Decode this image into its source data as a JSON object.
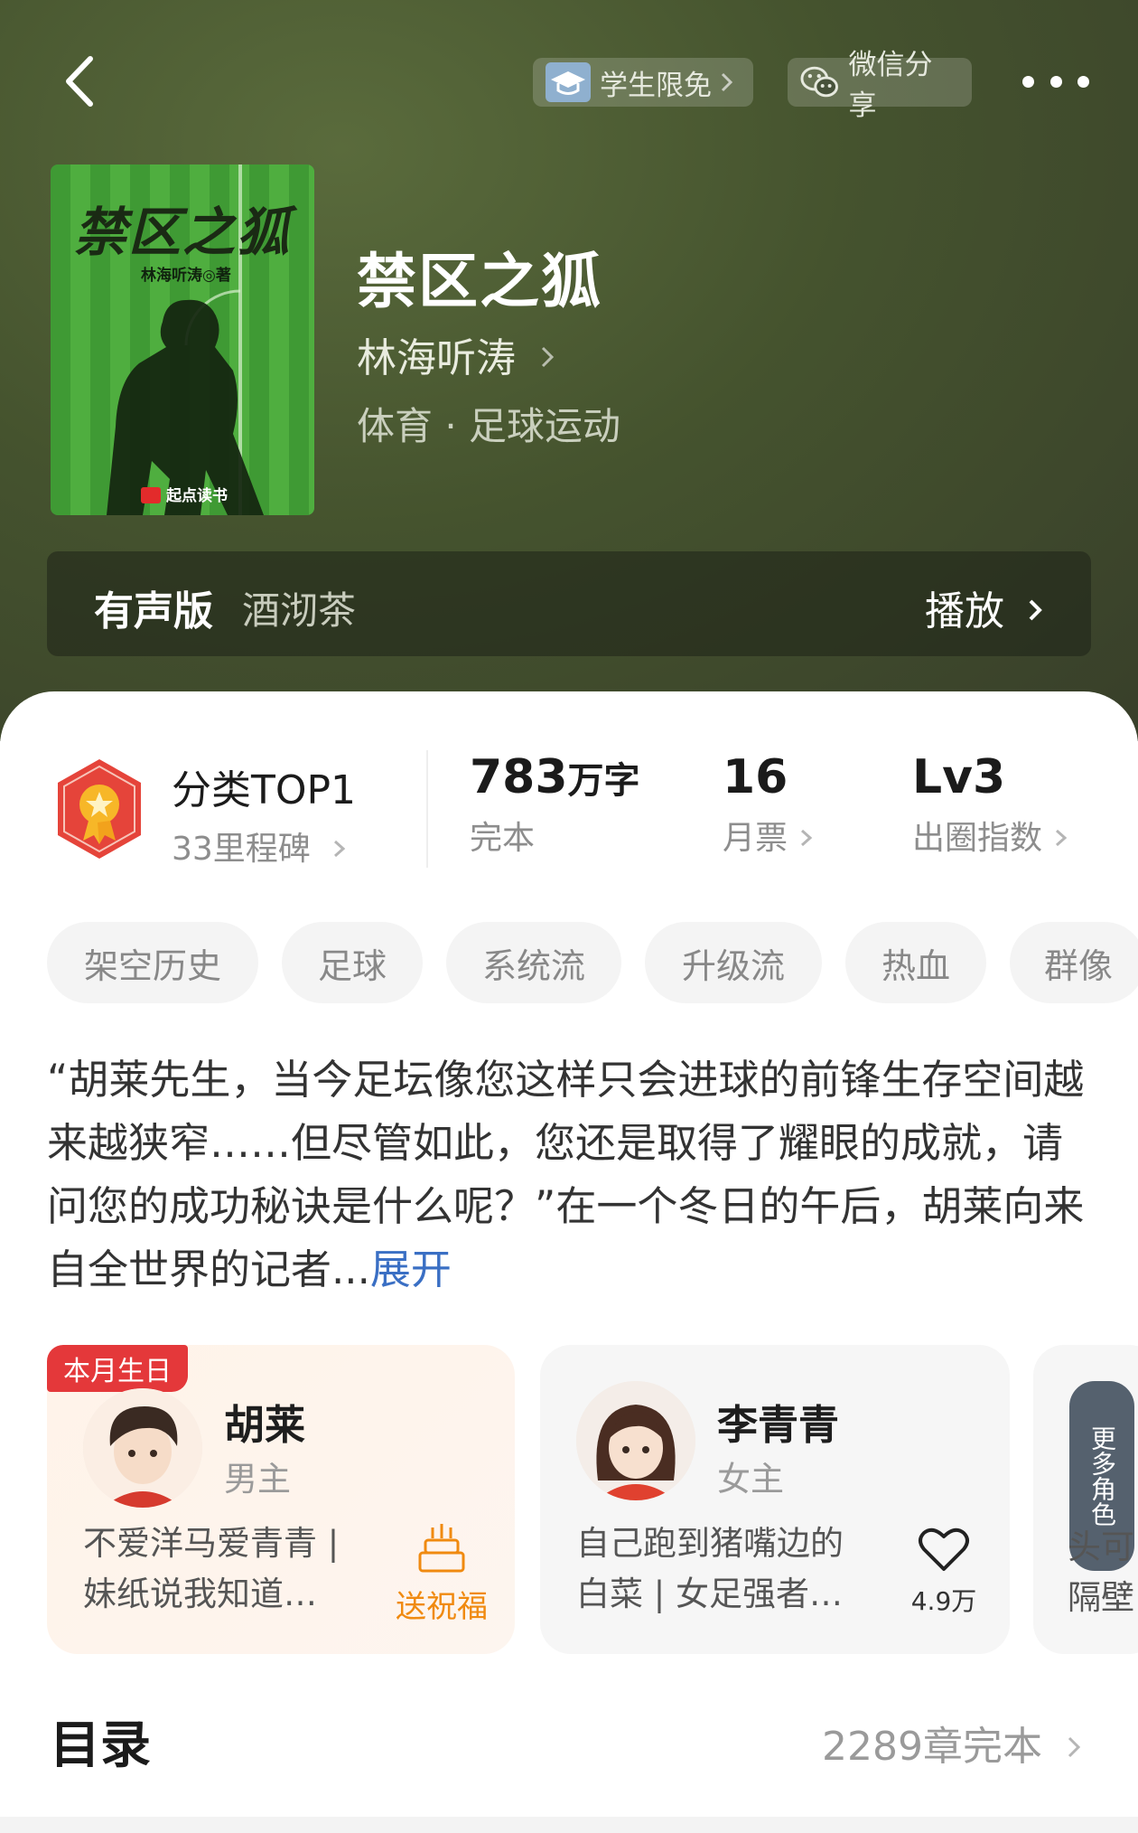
{
  "header": {
    "student_free_label": "学生限免",
    "wechat_share_label": "微信分享"
  },
  "book": {
    "cover_title": "禁区之狐",
    "cover_author": "林海听涛◎著",
    "cover_publisher": "起点读书",
    "title": "禁区之狐",
    "author": "林海听涛",
    "genre": "体育 · 足球运动"
  },
  "audio": {
    "label": "有声版",
    "narrator": "酒沏茶",
    "play_label": "播放"
  },
  "stats": {
    "rank_title": "分类TOP1",
    "milestones": "33里程碑",
    "word_count": "783",
    "word_unit": "万字",
    "status": "完本",
    "monthly_votes": "16",
    "monthly_votes_label": "月票",
    "influence_level": "Lv3",
    "influence_label": "出圈指数"
  },
  "tags": [
    "架空历史",
    "足球",
    "系统流",
    "升级流",
    "热血",
    "群像"
  ],
  "synopsis": {
    "text": "“胡莱先生，当今足坛像您这样只会进球的前锋生存空间越来越狭窄……但尽管如此，您还是取得了耀眼的成就，请问您的成功秘诀是什么呢？”在一个冬日的午后，胡莱向来自全世界的记者...",
    "expand_label": "展开"
  },
  "characters": [
    {
      "badge": "本月生日",
      "name": "胡莱",
      "role": "男主",
      "desc": "不爱洋马爱青青 | 妹纸说我知道…",
      "action_label": "送祝福"
    },
    {
      "name": "李青青",
      "role": "女主",
      "desc": "自己跑到猪嘴边的白菜 | 女足强者…",
      "likes": "4.9万"
    }
  ],
  "more_roles": {
    "label": "更多角色",
    "peek_line1": "头可",
    "peek_line2": "隔壁"
  },
  "toc": {
    "title": "目录",
    "status": "2289章完本"
  },
  "colors": {
    "hero_bg": "#45532e",
    "expand_link": "#3a6fc4",
    "birthday_badge": "#e4383a",
    "bless_orange": "#f08a10"
  }
}
